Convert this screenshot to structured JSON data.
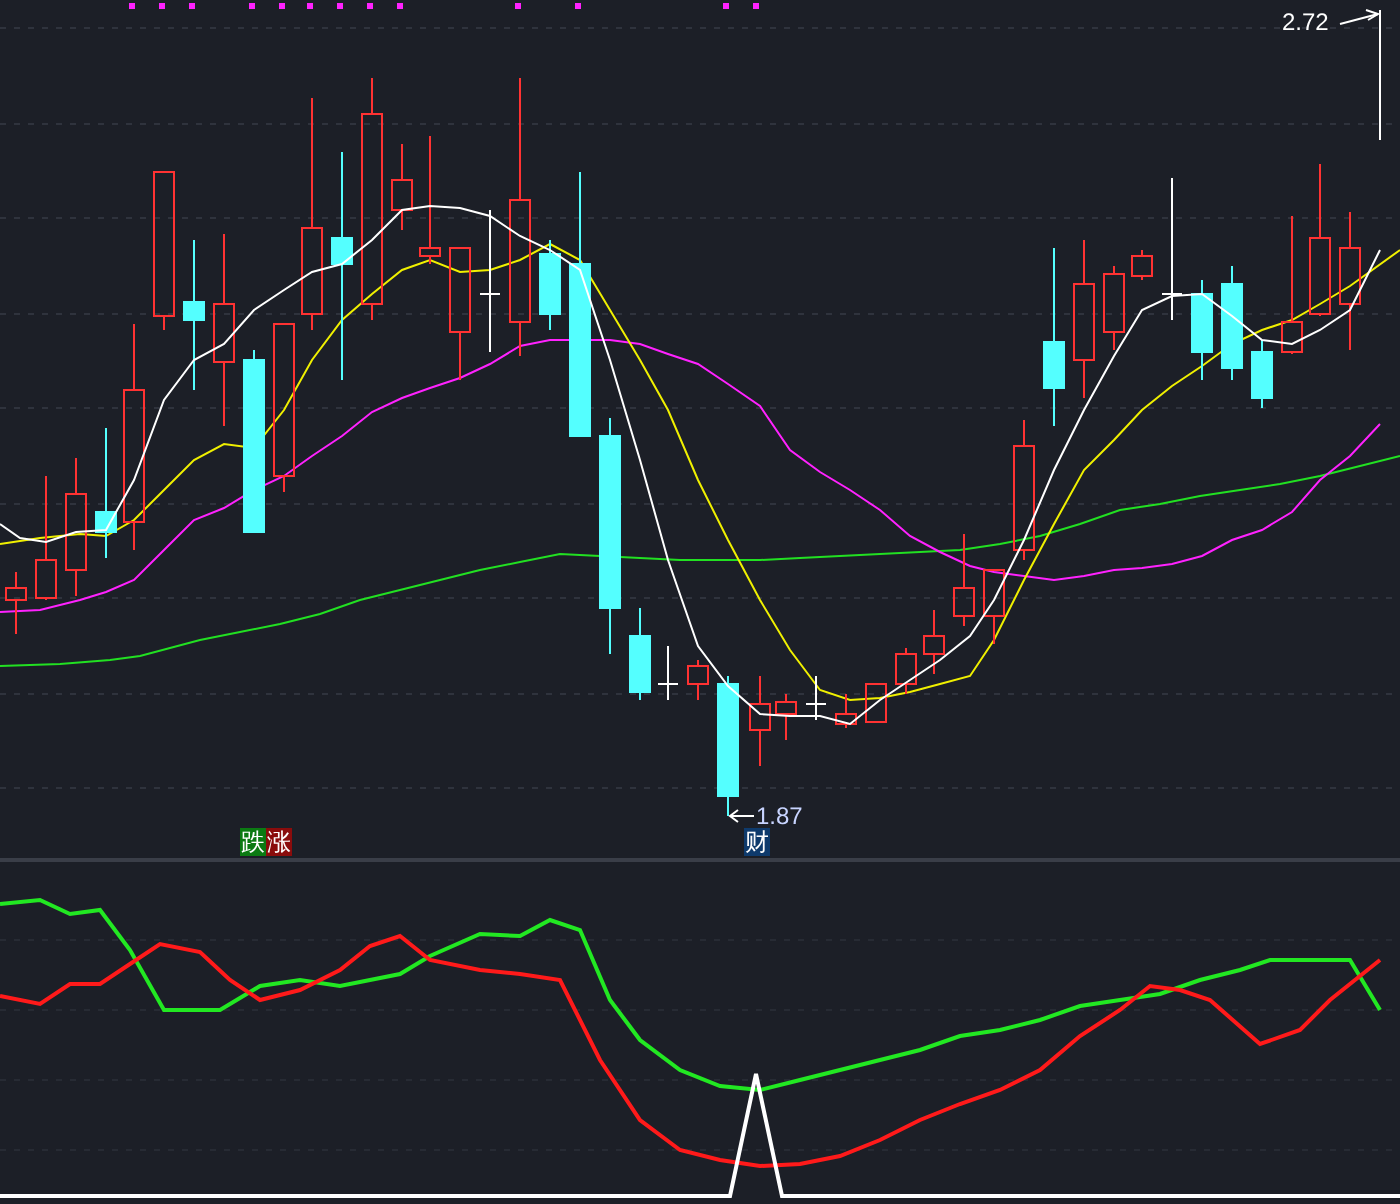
{
  "price_chart": {
    "high_label": "2.72",
    "low_label": "1.87"
  },
  "markers": [
    {
      "text": "跌",
      "color": "#0b7a12"
    },
    {
      "text": "涨",
      "color": "#8a0c0c"
    },
    {
      "text": "财",
      "color": "#0e3a6c"
    }
  ]
}
